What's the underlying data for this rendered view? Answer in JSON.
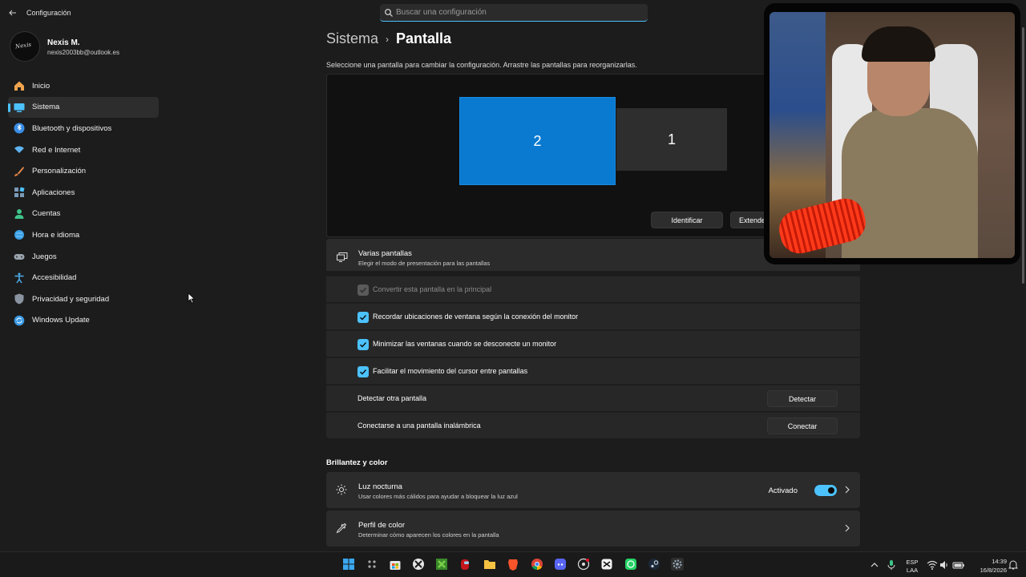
{
  "window": {
    "title": "Configuración"
  },
  "search": {
    "placeholder": "Buscar una configuración"
  },
  "profile": {
    "name": "Nexis M.",
    "email": "nexis2003bb@outlook.es",
    "avatar_text": "Nexis"
  },
  "sidebar": {
    "items": [
      {
        "label": "Inicio",
        "icon": "home-icon",
        "color": "#f0a44c"
      },
      {
        "label": "Sistema",
        "icon": "system-icon",
        "color": "#4cc2ff",
        "active": true
      },
      {
        "label": "Bluetooth y dispositivos",
        "icon": "bluetooth-icon",
        "color": "#3a8ee6"
      },
      {
        "label": "Red e Internet",
        "icon": "network-icon",
        "color": "#5fb3f2"
      },
      {
        "label": "Personalización",
        "icon": "brush-icon",
        "color": "#e98a4c"
      },
      {
        "label": "Aplicaciones",
        "icon": "apps-icon",
        "color": "#7a9ab8"
      },
      {
        "label": "Cuentas",
        "icon": "accounts-icon",
        "color": "#3ec48a"
      },
      {
        "label": "Hora e idioma",
        "icon": "time-language-icon",
        "color": "#3aa0e6"
      },
      {
        "label": "Juegos",
        "icon": "gaming-icon",
        "color": "#9aa4ae"
      },
      {
        "label": "Accesibilidad",
        "icon": "accessibility-icon",
        "color": "#4cb0f0"
      },
      {
        "label": "Privacidad y seguridad",
        "icon": "shield-icon",
        "color": "#8a94a0"
      },
      {
        "label": "Windows Update",
        "icon": "update-icon",
        "color": "#3a9ae6"
      }
    ]
  },
  "breadcrumb": {
    "parent": "Sistema",
    "separator": "›",
    "current": "Pantalla"
  },
  "display": {
    "description": "Seleccione una pantalla para cambiar la configuración. Arrastre las pantallas para reorganizarlas.",
    "monitor_2": "2",
    "monitor_1": "1",
    "identify_label": "Identificar",
    "extend_label": "Extender"
  },
  "multiple_displays": {
    "title": "Varias pantallas",
    "subtitle": "Elegir el modo de presentación para las pantallas",
    "options": [
      {
        "label": "Convertir esta pantalla en la principal",
        "checked": true,
        "disabled": true
      },
      {
        "label": "Recordar ubicaciones de ventana según la conexión del monitor",
        "checked": true,
        "disabled": false
      },
      {
        "label": "Minimizar las ventanas cuando se desconecte un monitor",
        "checked": true,
        "disabled": false
      },
      {
        "label": "Facilitar el movimiento del cursor entre pantallas",
        "checked": true,
        "disabled": false
      }
    ],
    "detect": {
      "label": "Detectar otra pantalla",
      "button": "Detectar"
    },
    "connect": {
      "label": "Conectarse a una pantalla inalámbrica",
      "button": "Conectar"
    }
  },
  "brightness": {
    "section_title": "Brillantez y color",
    "night_light": {
      "title": "Luz nocturna",
      "subtitle": "Usar colores más cálidos para ayudar a bloquear la luz azul",
      "status": "Activado",
      "enabled": true
    },
    "color_profile": {
      "title": "Perfil de color",
      "subtitle": "Determinar cómo aparecen los colores en la pantalla"
    }
  },
  "taskbar": {
    "apps": [
      "windows-start-icon",
      "task-view-icon",
      "store-icon",
      "xbox-icon",
      "minecraft-icon",
      "among-us-icon",
      "brave-icon",
      "explorer-icon",
      "chrome-icon",
      "discord-icon",
      "obs-icon",
      "capcut-icon",
      "whatsapp-icon",
      "steam-icon",
      "settings-icon"
    ],
    "language_top": "ESP",
    "language_bottom": "LAA",
    "time": "14:39",
    "date": "16/8/2026"
  },
  "colors": {
    "accent": "#4cc2ff",
    "monitor_selected": "#0a7ad0",
    "background": "#1c1c1c",
    "card": "#2b2b2b"
  }
}
